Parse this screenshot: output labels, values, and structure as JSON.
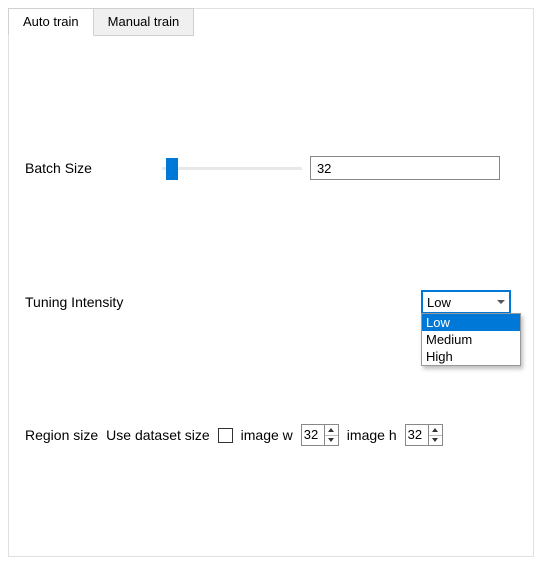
{
  "tabs": {
    "auto": "Auto train",
    "manual": "Manual train"
  },
  "batch": {
    "label": "Batch Size",
    "value": "32"
  },
  "tuning": {
    "label": "Tuning Intensity",
    "selected": "Low",
    "options": [
      "Low",
      "Medium",
      "High"
    ]
  },
  "region": {
    "label": "Region size",
    "use_dataset_label": "Use dataset size",
    "image_w_label": "image w",
    "image_w_value": "32",
    "image_h_label": "image h",
    "image_h_value": "32"
  }
}
